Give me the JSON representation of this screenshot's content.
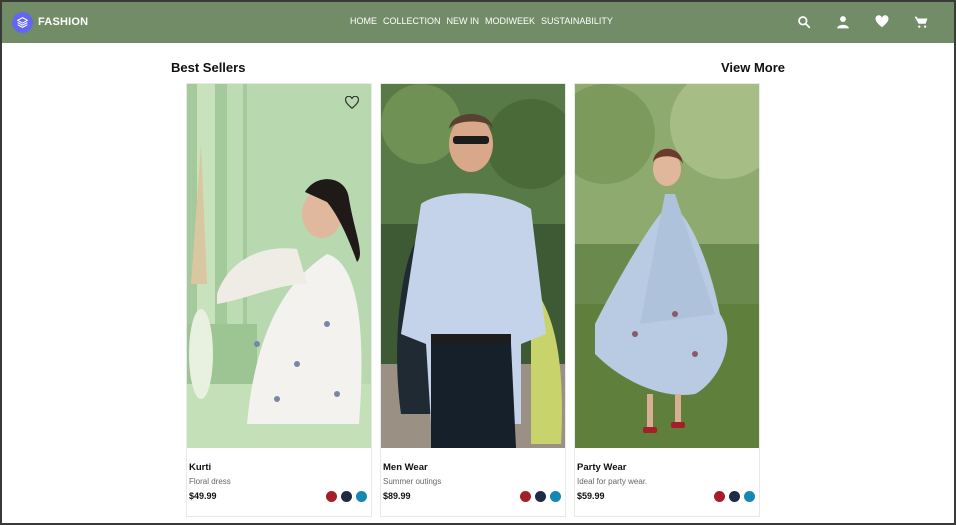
{
  "brand": {
    "name": "FASHION",
    "icon": "layers-icon"
  },
  "nav": {
    "items": [
      "HOME",
      "COLLECTION",
      "NEW IN",
      "MODIWEEK",
      "SUSTAINABILITY"
    ]
  },
  "header_icons": [
    "search-icon",
    "user-icon",
    "heart-icon",
    "cart-icon"
  ],
  "section": {
    "title": "Best Sellers",
    "view_more": "View More"
  },
  "products": [
    {
      "name": "Kurti",
      "desc": "Floral dress",
      "price": "$49.99"
    },
    {
      "name": "Men Wear",
      "desc": "Summer outings",
      "price": "$89.99"
    },
    {
      "name": "Party Wear",
      "desc": "Ideal for party wear.",
      "price": "$59.99"
    }
  ],
  "swatch_colors": [
    "#a3202a",
    "#1f2a44",
    "#1687b0"
  ],
  "colors": {
    "navbar": "#738c68",
    "logo_badge": "#6366f1"
  }
}
